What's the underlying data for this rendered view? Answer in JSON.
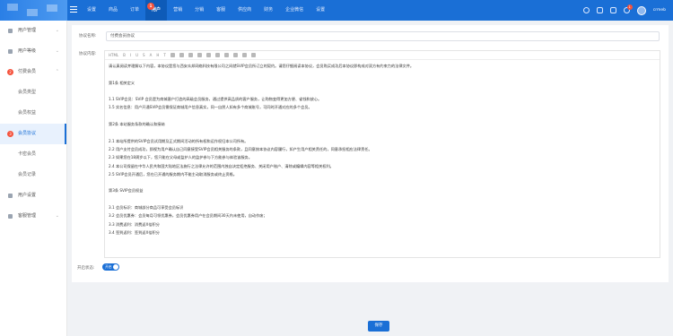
{
  "header": {
    "nav": [
      {
        "label": "设置"
      },
      {
        "label": "商品"
      },
      {
        "label": "订单"
      },
      {
        "label": "用户",
        "badge": "1"
      },
      {
        "label": "营销"
      },
      {
        "label": "分销"
      },
      {
        "label": "客服"
      },
      {
        "label": "供应商"
      },
      {
        "label": "财务"
      },
      {
        "label": "企业微信"
      },
      {
        "label": "设置"
      }
    ],
    "notification_badge": "1",
    "user_name": "crmeb"
  },
  "sidebar": {
    "items": [
      {
        "label": "用户管理",
        "icon": "user-icon"
      },
      {
        "label": "用户等级",
        "icon": "level-icon"
      },
      {
        "label": "付费会员",
        "icon": "vip-icon",
        "badge": "2"
      },
      {
        "label": "会员类型"
      },
      {
        "label": "会员权益"
      },
      {
        "label": "会员协议",
        "badge": "3"
      },
      {
        "label": "卡密会员"
      },
      {
        "label": "会员记录"
      },
      {
        "label": "用户设置",
        "icon": "settings-icon"
      },
      {
        "label": "客服管理",
        "icon": "service-icon"
      }
    ]
  },
  "form": {
    "title_label": "协议名称:",
    "title_value": "付费会员协议",
    "content_label": "协议内容:",
    "status_label": "开启状态:",
    "status_toggle": "开启",
    "save_label": "保存"
  },
  "editor": {
    "toolbar": [
      "HTML",
      "B",
      "I",
      "U",
      "S",
      "A",
      "H",
      "T",
      "list",
      "align",
      "link",
      "image",
      "video",
      "table",
      "code",
      "undo",
      "redo",
      "full"
    ],
    "lines": [
      "请认真阅读并理解以下内容，本协议是您与西安众邦网络科技有限公司之间就SVIP会员所订立的契约。请您仔细阅读本协议，会员购买成功后本协议即构成对双方有约束力的法律文件。",
      "",
      "第1条 相关定义",
      "",
      "1.1 SVIP会员：SVIP 会员是为商城客户打造的高级会员服务，通过提供高品质的客户服务，让购物变得更加方便、省钱和放心。",
      "1.5 实名信息：用户开通SVIP会员需保证商城用户信息真实，同一自然人如有多个商城账号，可同时开通对应的多个会员。",
      "",
      "第2条 本站服务条款的确认和接纳",
      "",
      "2.1 本站所提供的SVIP会员试用期及正式期间活动的所有权和运作权归本公司所有。",
      "2.2 用户支付会员成功，即视为用户确认自己同意接受SVIP会员相关服务的条款，且同意按本协议内容履行，如产生用户相关责任的，同意承担相应法律责任。",
      "2.3 如果您在18周岁以下，您只能在父母或监护人的监护参与下方能参与体验该服务。",
      "2.4 本公司保留在中华人民共和国大陆地区法施行之法律允许的范围内独自决定拒绝服务、关闭用户账户、清除或编辑内容等相关权利。",
      "2.5 SVIP会员开通后，您在已开通的服务期内不能主动取消服务或终止资格。",
      "",
      "第3条 SVIP会员权益",
      "",
      "3.1 会员标识：商城部分商品可享受会员标识",
      "3.2 会员优惠券：会员每月可领优惠券，会员优惠券用户在会员期间30天内未使用，自动作废；",
      "3.3 消费返利：消费返X倍积分",
      "3.4 签到返利：签到返X倍积分"
    ]
  },
  "colors": {
    "primary": "#1a6fd6",
    "badge": "#f5533d",
    "sidebar_active_bg": "#e8f1fd"
  }
}
